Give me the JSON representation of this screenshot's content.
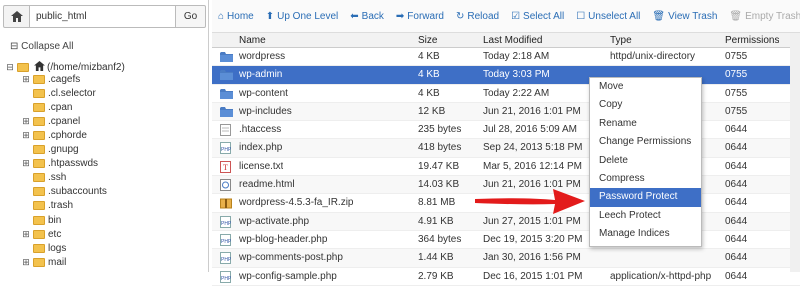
{
  "left": {
    "path_value": "public_html",
    "go_label": "Go",
    "collapse_label": "Collapse All",
    "tree": [
      {
        "label": "(/home/mizbanf2)",
        "toggle": "⊟"
      },
      {
        "label": ".cagefs",
        "toggle": "⊞"
      },
      {
        "label": ".cl.selector",
        "toggle": ""
      },
      {
        "label": ".cpan",
        "toggle": ""
      },
      {
        "label": ".cpanel",
        "toggle": "⊞"
      },
      {
        "label": ".cphorde",
        "toggle": "⊞"
      },
      {
        "label": ".gnupg",
        "toggle": ""
      },
      {
        "label": ".htpasswds",
        "toggle": "⊞"
      },
      {
        "label": ".ssh",
        "toggle": ""
      },
      {
        "label": ".subaccounts",
        "toggle": ""
      },
      {
        "label": ".trash",
        "toggle": ""
      },
      {
        "label": "bin",
        "toggle": ""
      },
      {
        "label": "etc",
        "toggle": "⊞"
      },
      {
        "label": "logs",
        "toggle": ""
      },
      {
        "label": "mail",
        "toggle": "⊞"
      }
    ]
  },
  "toolbar": [
    {
      "label": "Home",
      "icon": "home-icon",
      "glyph": "⌂",
      "disabled": false
    },
    {
      "label": "Up One Level",
      "icon": "up-arrow-icon",
      "glyph": "⬆",
      "disabled": false
    },
    {
      "label": "Back",
      "icon": "back-arrow-icon",
      "glyph": "⬅",
      "disabled": false
    },
    {
      "label": "Forward",
      "icon": "forward-arrow-icon",
      "glyph": "➡",
      "disabled": false
    },
    {
      "label": "Reload",
      "icon": "reload-icon",
      "glyph": "↻",
      "disabled": false
    },
    {
      "label": "Select All",
      "icon": "select-all-icon",
      "glyph": "☑",
      "disabled": false
    },
    {
      "label": "Unselect All",
      "icon": "unselect-all-icon",
      "glyph": "☐",
      "disabled": false
    },
    {
      "label": "View Trash",
      "icon": "trash-icon",
      "glyph": "🗑",
      "disabled": false
    },
    {
      "label": "Empty Trash",
      "icon": "empty-trash-icon",
      "glyph": "🗑",
      "disabled": true
    }
  ],
  "table": {
    "headers": {
      "name": "Name",
      "size": "Size",
      "modified": "Last Modified",
      "type": "Type",
      "perms": "Permissions"
    },
    "rows": [
      {
        "name": "wordpress",
        "size": "4 KB",
        "modified": "Today 2:18 AM",
        "type": "httpd/unix-directory",
        "perms": "0755",
        "icon": "folder-icon",
        "selected": false
      },
      {
        "name": "wp-admin",
        "size": "4 KB",
        "modified": "Today 3:03 PM",
        "type": "",
        "perms": "0755",
        "icon": "folder-icon",
        "selected": true
      },
      {
        "name": "wp-content",
        "size": "4 KB",
        "modified": "Today 2:22 AM",
        "type": "",
        "perms": "0755",
        "icon": "folder-icon",
        "selected": false
      },
      {
        "name": "wp-includes",
        "size": "12 KB",
        "modified": "Jun 21, 2016 1:01 PM",
        "type": "",
        "perms": "0755",
        "icon": "folder-icon",
        "selected": false
      },
      {
        "name": ".htaccess",
        "size": "235 bytes",
        "modified": "Jul 28, 2016 5:09 AM",
        "type": "",
        "perms": "0644",
        "icon": "text-file-icon",
        "selected": false
      },
      {
        "name": "index.php",
        "size": "418 bytes",
        "modified": "Sep 24, 2013 5:18 PM",
        "type": "",
        "perms": "0644",
        "icon": "php-file-icon",
        "selected": false
      },
      {
        "name": "license.txt",
        "size": "19.47 KB",
        "modified": "Mar 5, 2016 12:14 PM",
        "type": "",
        "perms": "0644",
        "icon": "txt-file-icon",
        "selected": false
      },
      {
        "name": "readme.html",
        "size": "14.03 KB",
        "modified": "Jun 21, 2016 1:01 PM",
        "type": "",
        "perms": "0644",
        "icon": "html-file-icon",
        "selected": false
      },
      {
        "name": "wordpress-4.5.3-fa_IR.zip",
        "size": "8.81 MB",
        "modified": "",
        "type": "",
        "perms": "0644",
        "icon": "zip-file-icon",
        "selected": false
      },
      {
        "name": "wp-activate.php",
        "size": "4.91 KB",
        "modified": "Jun 27, 2015 1:01 PM",
        "type": "",
        "perms": "0644",
        "icon": "php-file-icon",
        "selected": false
      },
      {
        "name": "wp-blog-header.php",
        "size": "364 bytes",
        "modified": "Dec 19, 2015 3:20 PM",
        "type": "",
        "perms": "0644",
        "icon": "php-file-icon",
        "selected": false
      },
      {
        "name": "wp-comments-post.php",
        "size": "1.44 KB",
        "modified": "Jan 30, 2016 1:56 PM",
        "type": "",
        "perms": "0644",
        "icon": "php-file-icon",
        "selected": false
      },
      {
        "name": "wp-config-sample.php",
        "size": "2.79 KB",
        "modified": "Dec 16, 2015 1:01 PM",
        "type": "application/x-httpd-php",
        "perms": "0644",
        "icon": "php-file-icon",
        "selected": false
      }
    ]
  },
  "context_menu": [
    {
      "label": "Move",
      "highlighted": false
    },
    {
      "label": "Copy",
      "highlighted": false
    },
    {
      "label": "Rename",
      "highlighted": false
    },
    {
      "label": "Change Permissions",
      "highlighted": false
    },
    {
      "label": "Delete",
      "highlighted": false
    },
    {
      "label": "Compress",
      "highlighted": false
    },
    {
      "label": "Password Protect",
      "highlighted": true
    },
    {
      "label": "Leech Protect",
      "highlighted": false
    },
    {
      "label": "Manage Indices",
      "highlighted": false
    }
  ],
  "colors": {
    "accent": "#2a6db5",
    "selection": "#3e6fc6",
    "annotation_arrow": "#e31b1b",
    "folder": "#f3c24d"
  }
}
